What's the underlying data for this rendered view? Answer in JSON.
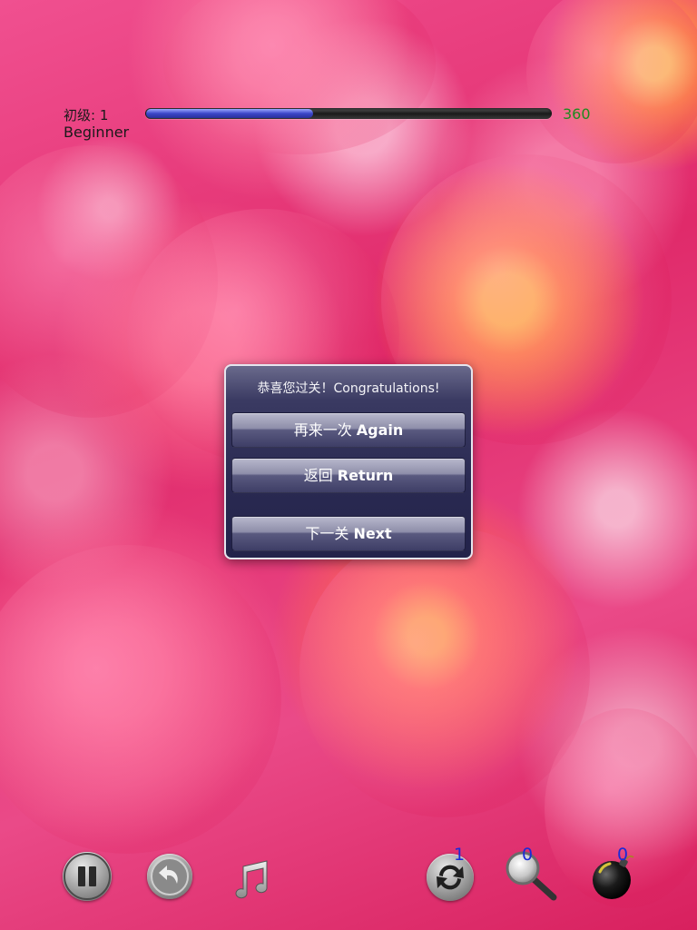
{
  "hud": {
    "level_cn": "初级: 1",
    "level_en": "Beginner",
    "progress": 0.41,
    "score": "360",
    "colors": {
      "score": "#1f8a1f",
      "progress_fill": "#3b46c8"
    }
  },
  "dialog": {
    "title": "恭喜您过关！Congratulations!",
    "again": {
      "cn": "再来一次",
      "en": "Again"
    },
    "return": {
      "cn": "返回",
      "en": "Return"
    },
    "next": {
      "cn": "下一关",
      "en": "Next"
    }
  },
  "toolbar": {
    "pause_icon": "pause-icon",
    "undo_icon": "undo-icon",
    "music_icon": "music-note-icon",
    "shuffle_icon": "shuffle-icon",
    "hint_icon": "magnifier-icon",
    "bomb_icon": "bomb-icon",
    "shuffle_count": "1",
    "hint_count": "0",
    "bomb_count": "0",
    "colors": {
      "count": "#1a2ad8"
    }
  }
}
